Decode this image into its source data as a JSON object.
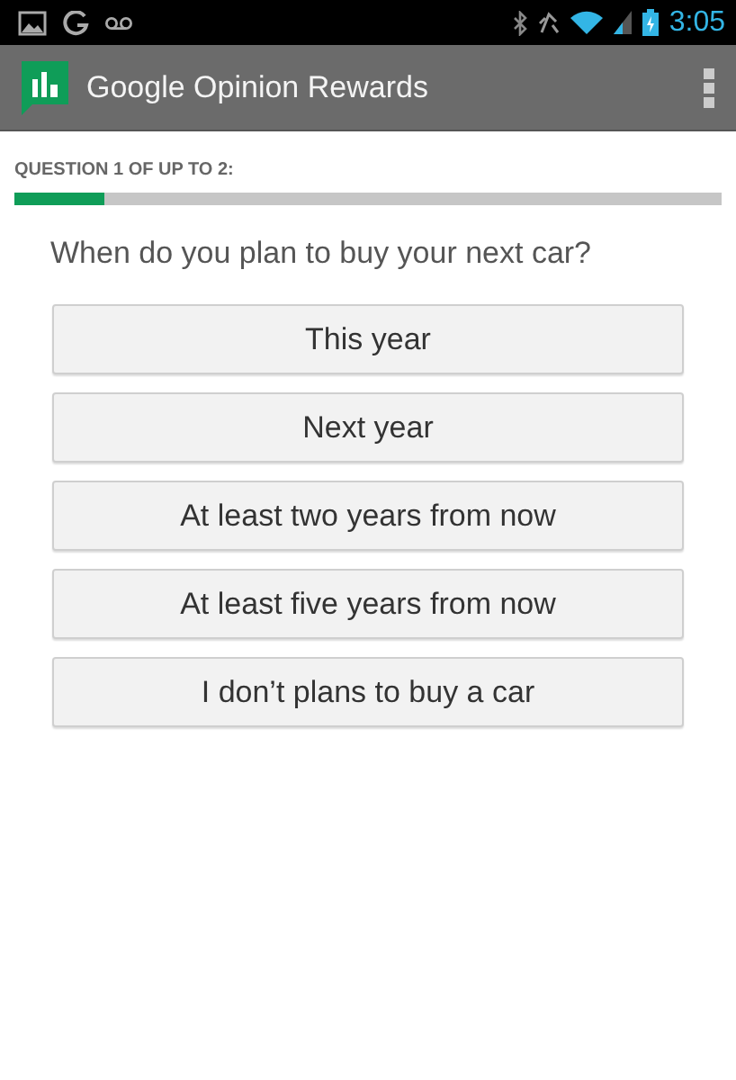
{
  "status_bar": {
    "time": "3:05"
  },
  "app_bar": {
    "title": "Google Opinion Rewards"
  },
  "progress": {
    "label": "QUESTION 1 OF UP TO 2:",
    "level": 0.127
  },
  "question": "When do you plan to buy your next car?",
  "options": [
    {
      "label": "This year"
    },
    {
      "label": "Next year"
    },
    {
      "label": "At least two years from now"
    },
    {
      "label": "At least five years from now"
    },
    {
      "label": "I don’t plans to buy a car"
    }
  ]
}
